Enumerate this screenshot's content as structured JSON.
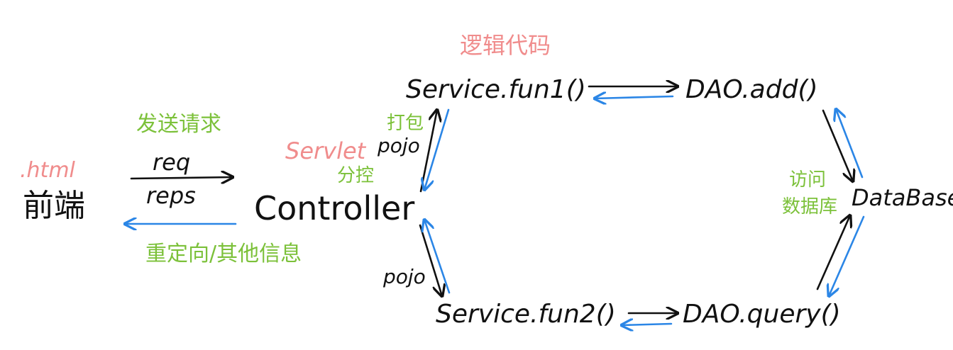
{
  "colors": {
    "ink": "#111111",
    "pink": "#f08c8c",
    "green": "#7cc13a",
    "blue": "#2b86e6"
  },
  "nodes": {
    "frontend_tag": ".html",
    "frontend": "前端",
    "controller_tag": "Servlet",
    "controller": "Controller",
    "service_fun1": "Service.fun1()",
    "service_fun2": "Service.fun2()",
    "dao_add": "DAO.add()",
    "dao_query": "DAO.query()",
    "database": "DataBase"
  },
  "labels": {
    "send_request": "发送请求",
    "req": "req",
    "reps": "reps",
    "redirect_other": "重定向/其他信息",
    "dispatch": "分控",
    "pack": "打包",
    "pojo_top": "pojo",
    "pojo_bottom": "pojo",
    "logic_code": "逻辑代码",
    "access_db_line1": "访问",
    "access_db_line2": "数据库"
  }
}
